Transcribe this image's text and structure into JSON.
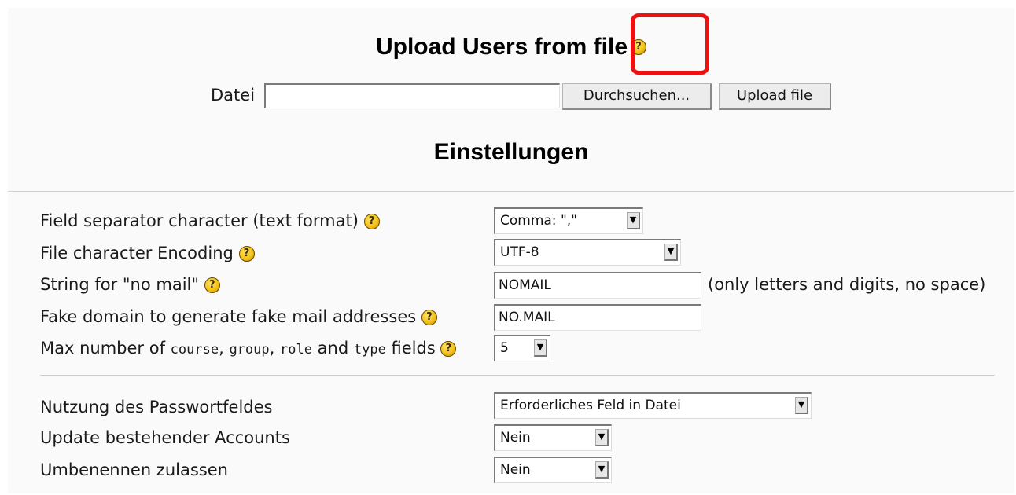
{
  "upload": {
    "title": "Upload Users from file",
    "file_label": "Datei",
    "file_value": "",
    "browse_button": "Durchsuchen...",
    "upload_button": "Upload file"
  },
  "settings": {
    "heading": "Einstellungen",
    "field_separator": {
      "label": "Field separator character (text format)",
      "value": "Comma: \",\""
    },
    "encoding": {
      "label": "File character Encoding",
      "value": "UTF-8"
    },
    "nomail": {
      "label": "String for \"no mail\"",
      "value": "NOMAIL",
      "hint": "(only letters and digits, no space)"
    },
    "fake_domain": {
      "label": "Fake domain to generate fake mail addresses",
      "value": "NO.MAIL"
    },
    "max_fields": {
      "label_pre": "Max number of",
      "course": "course",
      "sep1": ",",
      "group": "group",
      "sep2": ",",
      "role": "role",
      "and": "and",
      "type": "type",
      "label_post": "fields",
      "value": "5"
    },
    "password_usage": {
      "label": "Nutzung des Passwortfeldes",
      "value": "Erforderliches Feld in Datei"
    },
    "update_accounts": {
      "label": "Update bestehender Accounts",
      "value": "Nein"
    },
    "allow_rename": {
      "label": "Umbenennen zulassen",
      "value": "Nein"
    }
  },
  "help_icon_glyph": "?",
  "colors": {
    "highlight": "#ee1111",
    "help_icon": "#f3c21a"
  }
}
